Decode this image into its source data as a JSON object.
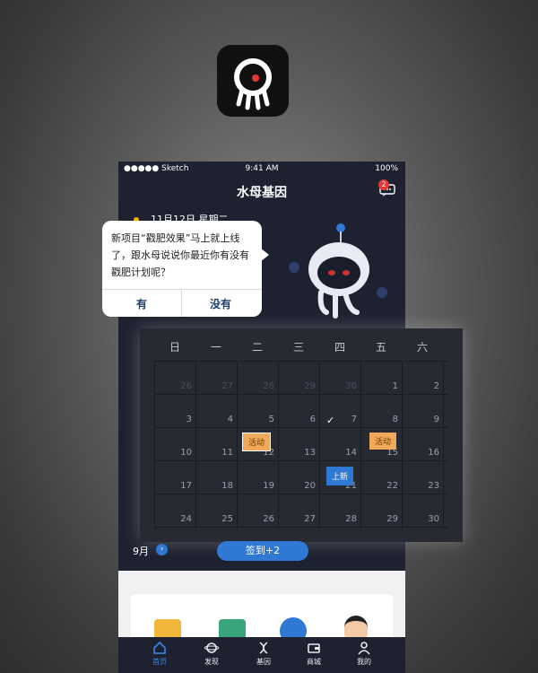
{
  "status_bar": {
    "carrier": "●●●●● Sketch",
    "time": "9:41 AM",
    "battery": "100%"
  },
  "header": {
    "title": "水母基因",
    "message_badge": "2"
  },
  "date_line": "11月12日 星期二",
  "bubble": {
    "text": "新项目“戳肥效果”马上就上线了，跟水母说说你最近你有没有戳肥计划呢？",
    "yes": "有",
    "no": "没有"
  },
  "calendar": {
    "weekdays": [
      "日",
      "一",
      "二",
      "三",
      "四",
      "五",
      "六"
    ],
    "rows": [
      [
        "26",
        "27",
        "28",
        "29",
        "30",
        "1",
        "2"
      ],
      [
        "3",
        "4",
        "5",
        "6",
        "7",
        "8",
        "9"
      ],
      [
        "10",
        "11",
        "12",
        "13",
        "14",
        "15",
        "16"
      ],
      [
        "17",
        "18",
        "19",
        "20",
        "21",
        "22",
        "23"
      ],
      [
        "24",
        "25",
        "26",
        "27",
        "28",
        "29",
        "30"
      ]
    ],
    "tag_activity_1": "活动",
    "tag_activity_2": "活动",
    "tag_new": "上新",
    "month": "9月",
    "sign_button": "签到+2"
  },
  "tabs": [
    "首页",
    "发现",
    "基因",
    "商城",
    "我的"
  ],
  "colors": {
    "accent": "#2f79d4",
    "badge": "#e53935",
    "tag": "#f0a85a",
    "dark_bg": "#1e2230"
  },
  "icons": [
    "jellyfish-logo-icon",
    "wifi-icon",
    "battery-icon",
    "message-icon",
    "sun-icon",
    "robot-mascot",
    "check-icon",
    "home-icon",
    "discover-icon",
    "gene-icon",
    "wallet-icon",
    "profile-icon"
  ]
}
